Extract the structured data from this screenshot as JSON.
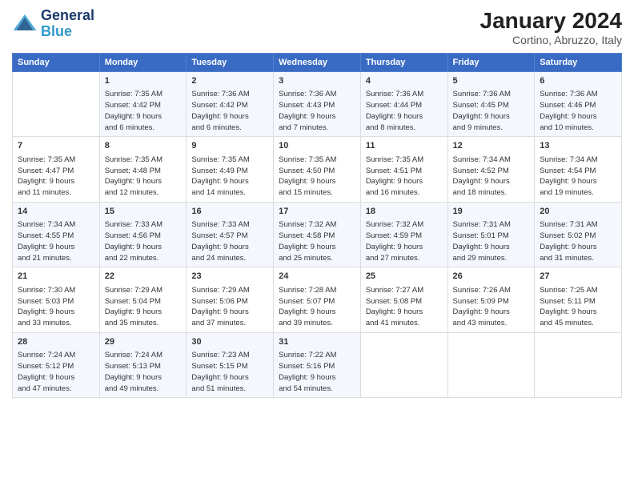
{
  "logo": {
    "line1": "General",
    "line2": "Blue"
  },
  "header": {
    "title": "January 2024",
    "subtitle": "Cortino, Abruzzo, Italy"
  },
  "days_of_week": [
    "Sunday",
    "Monday",
    "Tuesday",
    "Wednesday",
    "Thursday",
    "Friday",
    "Saturday"
  ],
  "weeks": [
    [
      {
        "day": "",
        "content": ""
      },
      {
        "day": "1",
        "content": "Sunrise: 7:35 AM\nSunset: 4:42 PM\nDaylight: 9 hours\nand 6 minutes."
      },
      {
        "day": "2",
        "content": "Sunrise: 7:36 AM\nSunset: 4:42 PM\nDaylight: 9 hours\nand 6 minutes."
      },
      {
        "day": "3",
        "content": "Sunrise: 7:36 AM\nSunset: 4:43 PM\nDaylight: 9 hours\nand 7 minutes."
      },
      {
        "day": "4",
        "content": "Sunrise: 7:36 AM\nSunset: 4:44 PM\nDaylight: 9 hours\nand 8 minutes."
      },
      {
        "day": "5",
        "content": "Sunrise: 7:36 AM\nSunset: 4:45 PM\nDaylight: 9 hours\nand 9 minutes."
      },
      {
        "day": "6",
        "content": "Sunrise: 7:36 AM\nSunset: 4:46 PM\nDaylight: 9 hours\nand 10 minutes."
      }
    ],
    [
      {
        "day": "7",
        "content": "Sunrise: 7:35 AM\nSunset: 4:47 PM\nDaylight: 9 hours\nand 11 minutes."
      },
      {
        "day": "8",
        "content": "Sunrise: 7:35 AM\nSunset: 4:48 PM\nDaylight: 9 hours\nand 12 minutes."
      },
      {
        "day": "9",
        "content": "Sunrise: 7:35 AM\nSunset: 4:49 PM\nDaylight: 9 hours\nand 14 minutes."
      },
      {
        "day": "10",
        "content": "Sunrise: 7:35 AM\nSunset: 4:50 PM\nDaylight: 9 hours\nand 15 minutes."
      },
      {
        "day": "11",
        "content": "Sunrise: 7:35 AM\nSunset: 4:51 PM\nDaylight: 9 hours\nand 16 minutes."
      },
      {
        "day": "12",
        "content": "Sunrise: 7:34 AM\nSunset: 4:52 PM\nDaylight: 9 hours\nand 18 minutes."
      },
      {
        "day": "13",
        "content": "Sunrise: 7:34 AM\nSunset: 4:54 PM\nDaylight: 9 hours\nand 19 minutes."
      }
    ],
    [
      {
        "day": "14",
        "content": "Sunrise: 7:34 AM\nSunset: 4:55 PM\nDaylight: 9 hours\nand 21 minutes."
      },
      {
        "day": "15",
        "content": "Sunrise: 7:33 AM\nSunset: 4:56 PM\nDaylight: 9 hours\nand 22 minutes."
      },
      {
        "day": "16",
        "content": "Sunrise: 7:33 AM\nSunset: 4:57 PM\nDaylight: 9 hours\nand 24 minutes."
      },
      {
        "day": "17",
        "content": "Sunrise: 7:32 AM\nSunset: 4:58 PM\nDaylight: 9 hours\nand 25 minutes."
      },
      {
        "day": "18",
        "content": "Sunrise: 7:32 AM\nSunset: 4:59 PM\nDaylight: 9 hours\nand 27 minutes."
      },
      {
        "day": "19",
        "content": "Sunrise: 7:31 AM\nSunset: 5:01 PM\nDaylight: 9 hours\nand 29 minutes."
      },
      {
        "day": "20",
        "content": "Sunrise: 7:31 AM\nSunset: 5:02 PM\nDaylight: 9 hours\nand 31 minutes."
      }
    ],
    [
      {
        "day": "21",
        "content": "Sunrise: 7:30 AM\nSunset: 5:03 PM\nDaylight: 9 hours\nand 33 minutes."
      },
      {
        "day": "22",
        "content": "Sunrise: 7:29 AM\nSunset: 5:04 PM\nDaylight: 9 hours\nand 35 minutes."
      },
      {
        "day": "23",
        "content": "Sunrise: 7:29 AM\nSunset: 5:06 PM\nDaylight: 9 hours\nand 37 minutes."
      },
      {
        "day": "24",
        "content": "Sunrise: 7:28 AM\nSunset: 5:07 PM\nDaylight: 9 hours\nand 39 minutes."
      },
      {
        "day": "25",
        "content": "Sunrise: 7:27 AM\nSunset: 5:08 PM\nDaylight: 9 hours\nand 41 minutes."
      },
      {
        "day": "26",
        "content": "Sunrise: 7:26 AM\nSunset: 5:09 PM\nDaylight: 9 hours\nand 43 minutes."
      },
      {
        "day": "27",
        "content": "Sunrise: 7:25 AM\nSunset: 5:11 PM\nDaylight: 9 hours\nand 45 minutes."
      }
    ],
    [
      {
        "day": "28",
        "content": "Sunrise: 7:24 AM\nSunset: 5:12 PM\nDaylight: 9 hours\nand 47 minutes."
      },
      {
        "day": "29",
        "content": "Sunrise: 7:24 AM\nSunset: 5:13 PM\nDaylight: 9 hours\nand 49 minutes."
      },
      {
        "day": "30",
        "content": "Sunrise: 7:23 AM\nSunset: 5:15 PM\nDaylight: 9 hours\nand 51 minutes."
      },
      {
        "day": "31",
        "content": "Sunrise: 7:22 AM\nSunset: 5:16 PM\nDaylight: 9 hours\nand 54 minutes."
      },
      {
        "day": "",
        "content": ""
      },
      {
        "day": "",
        "content": ""
      },
      {
        "day": "",
        "content": ""
      }
    ]
  ]
}
